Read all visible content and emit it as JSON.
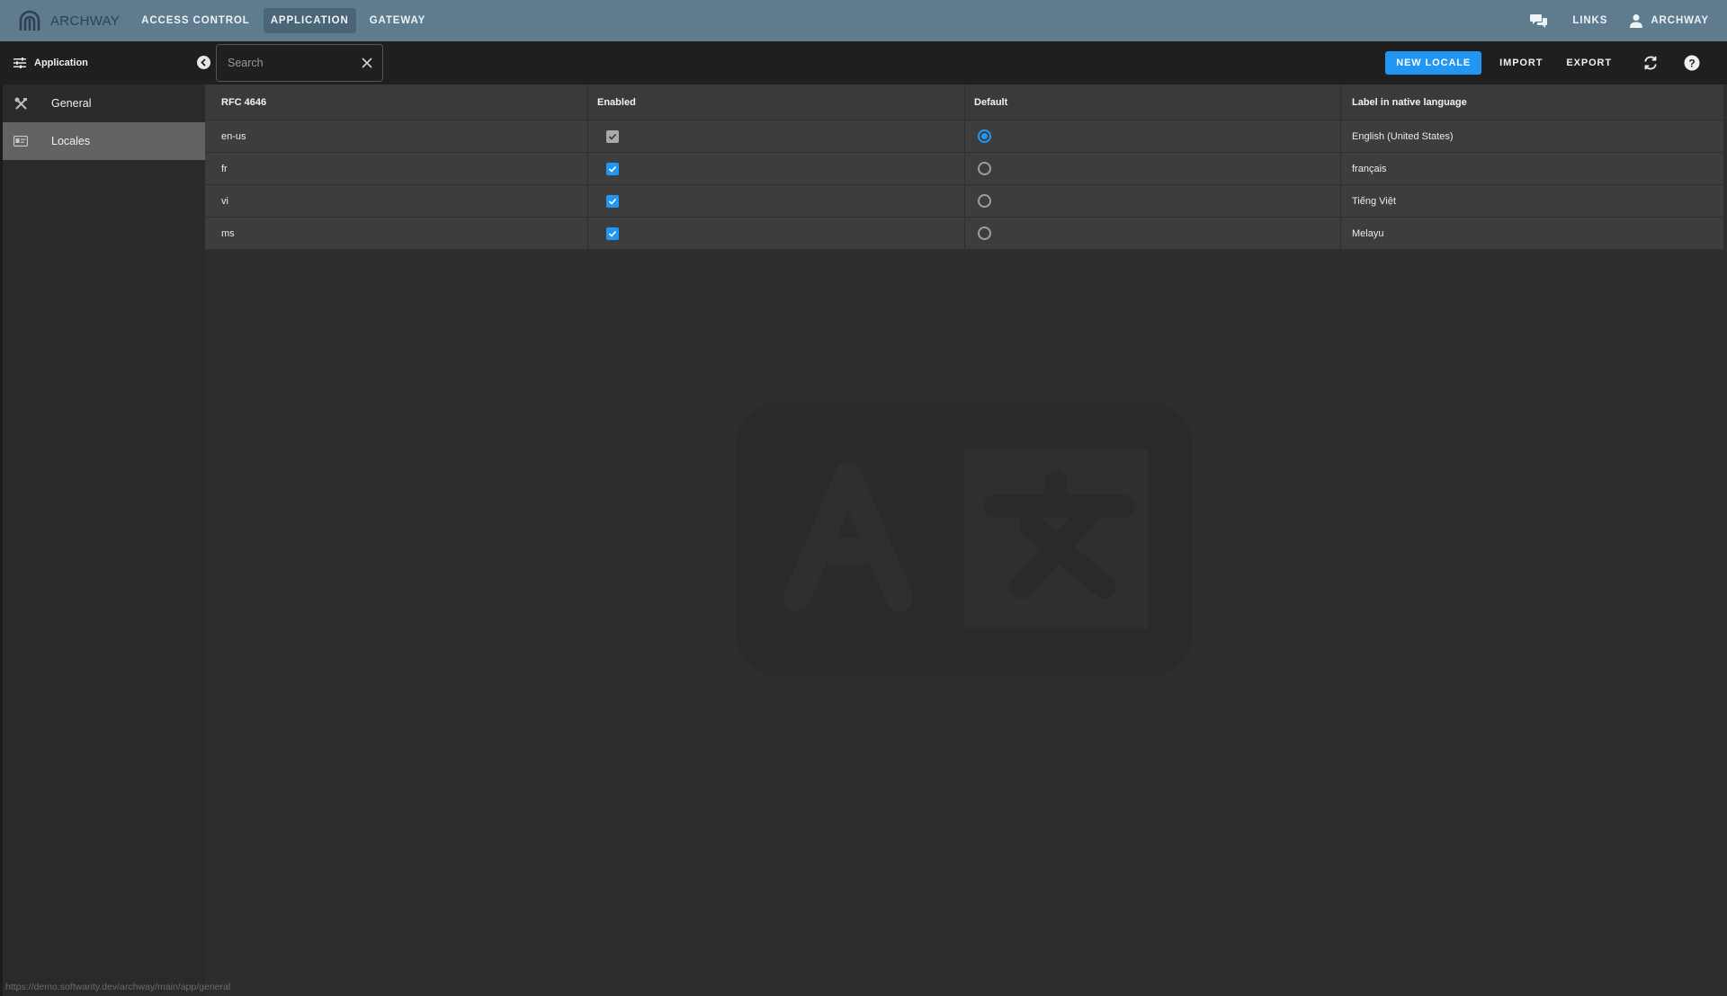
{
  "app": {
    "brand": "ARCHWAY",
    "nav": [
      {
        "label": "ACCESS CONTROL"
      },
      {
        "label": "APPLICATION"
      },
      {
        "label": "GATEWAY"
      }
    ],
    "active_nav": "APPLICATION",
    "links_label": "LINKS",
    "user_label": "ARCHWAY"
  },
  "sidebar": {
    "header": "Application",
    "items": [
      {
        "label": "General",
        "icon": "tools-icon"
      },
      {
        "label": "Locales",
        "icon": "id-card-icon"
      }
    ],
    "active_item": "Locales"
  },
  "toolbar": {
    "search_placeholder": "Search",
    "new_locale": "NEW LOCALE",
    "import": "IMPORT",
    "export": "EXPORT"
  },
  "table": {
    "columns": [
      "RFC 4646",
      "Enabled",
      "Default",
      "Label in native language"
    ],
    "rows": [
      {
        "code": "en-us",
        "enabled": true,
        "enabled_locked": true,
        "is_default": true,
        "label": "English (United States)"
      },
      {
        "code": "fr",
        "enabled": true,
        "enabled_locked": false,
        "is_default": false,
        "label": "français"
      },
      {
        "code": "vi",
        "enabled": true,
        "enabled_locked": false,
        "is_default": false,
        "label": "Tiếng Việt"
      },
      {
        "code": "ms",
        "enabled": true,
        "enabled_locked": false,
        "is_default": false,
        "label": "Melayu"
      }
    ]
  },
  "status_url": "https://demo.softwarity.dev/archway/main/app/general",
  "colors": {
    "topbar": "#5e7c8e",
    "accent": "#2196f3",
    "background": "#2e2e2e"
  }
}
